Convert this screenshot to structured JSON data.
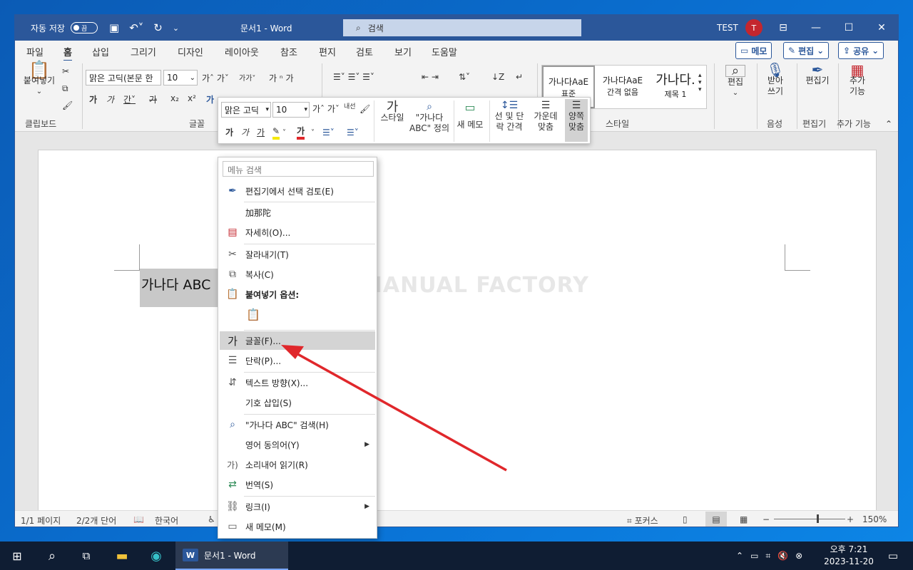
{
  "titlebar": {
    "autosave_label": "자동 저장",
    "autosave_state": "끔",
    "doc_title": "문서1 - Word",
    "search_placeholder": "검색",
    "user": "TEST",
    "avatar_initial": "T"
  },
  "tabs": [
    "파일",
    "홈",
    "삽입",
    "그리기",
    "디자인",
    "레이아웃",
    "참조",
    "편지",
    "검토",
    "보기",
    "도움말"
  ],
  "header_buttons": {
    "comment": "메모",
    "edit": "편집",
    "share": "공유"
  },
  "ribbon": {
    "clipboard": {
      "paste": "붙여넣기",
      "label": "클립보드"
    },
    "font": {
      "name": "맑은 고딕(본문 한",
      "size": "10",
      "label": "글꼴"
    },
    "styles": {
      "items": [
        "가나다AaE",
        "가나다AaE",
        "가나다."
      ],
      "subs": [
        "표준",
        "간격 없음",
        "제목 1"
      ],
      "label": "스타일"
    },
    "editing": {
      "btn": "편집",
      "label": ""
    },
    "voice": {
      "btn1": "받아",
      "btn2": "쓰기",
      "label": "음성"
    },
    "editor": {
      "btn": "편집기",
      "label": "편집기"
    },
    "addins": {
      "btn1": "추가",
      "btn2": "기능",
      "label": "추가 기능"
    }
  },
  "minitoolbar": {
    "font": "맑은 고딕",
    "size": "10",
    "style_btn": "스타일",
    "define_btn1": "\"가나다",
    "define_btn2": "ABC\" 정의",
    "comment_btn1": "새 메모",
    "linespace1": "선 및 단",
    "linespace2": "락 간격",
    "center1": "가운데",
    "center2": "맞춤",
    "justify1": "양쪽",
    "justify2": "맞춤"
  },
  "document": {
    "selected_text": "가나다 ABC",
    "watermark": "MANUAL FACTORY"
  },
  "context_menu": {
    "search_placeholder": "메뉴 검색",
    "items": [
      {
        "label": "편집기에서 선택 검토(E)"
      },
      {
        "label": "加那陀"
      },
      {
        "label": "자세히(O)..."
      },
      {
        "label": "잘라내기(T)"
      },
      {
        "label": "복사(C)"
      },
      {
        "label": "붙여넣기 옵션:"
      },
      {
        "label": "글꼴(F)..."
      },
      {
        "label": "단락(P)..."
      },
      {
        "label": "텍스트 방향(X)..."
      },
      {
        "label": "기호 삽입(S)"
      },
      {
        "label": "\"가나다 ABC\" 검색(H)"
      },
      {
        "label": "영어 동의어(Y)"
      },
      {
        "label": "소리내어 읽기(R)"
      },
      {
        "label": "번역(S)"
      },
      {
        "label": "링크(I)"
      },
      {
        "label": "새 메모(M)"
      }
    ]
  },
  "statusbar": {
    "page": "1/1 페이지",
    "words": "2/2개 단어",
    "lang": "한국어",
    "focus": "포커스",
    "zoom": "150%",
    "zoom_level": 0.6
  },
  "taskbar": {
    "word_item": "문서1 - Word",
    "time": "오후 7:21",
    "date": "2023-11-20"
  },
  "colors": {
    "word_blue": "#2b579a",
    "arrow_red": "#e0272b"
  }
}
